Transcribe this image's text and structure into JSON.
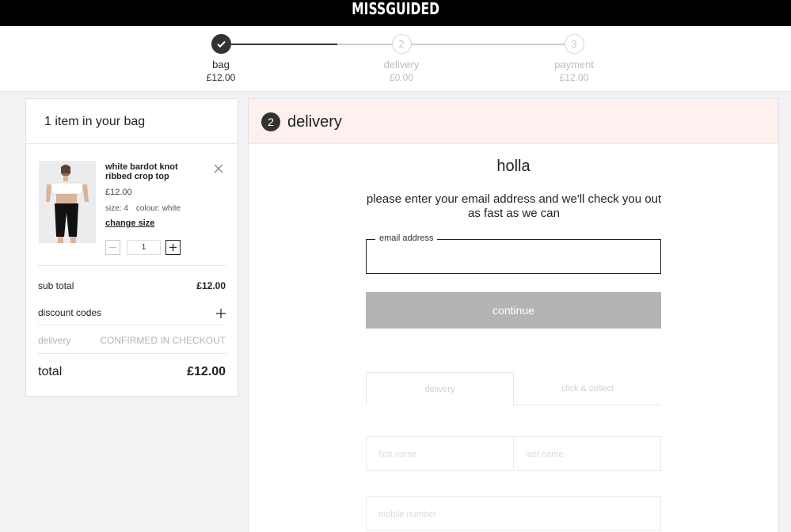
{
  "brand": {
    "logo_text": "MISSGUIDED"
  },
  "progress": {
    "steps": [
      {
        "number": "✓",
        "label": "bag",
        "amount": "£12.00",
        "state": "done"
      },
      {
        "number": "2",
        "label": "delivery",
        "amount": "£0.00",
        "state": "current"
      },
      {
        "number": "3",
        "label": "payment",
        "amount": "£12.00",
        "state": "upcoming"
      }
    ]
  },
  "bag": {
    "heading": "1 item in your bag",
    "item": {
      "name": "white bardot knot ribbed crop top",
      "price": "£12.00",
      "size": "size: 4",
      "colour": "colour: white",
      "change_size": "change size",
      "quantity": "1"
    },
    "summary": {
      "subtotal_label": "sub total",
      "subtotal_value": "£12.00",
      "discount_label": "discount codes",
      "delivery_label": "delivery",
      "delivery_value": "CONFIRMED IN CHECKOUT",
      "total_label": "total",
      "total_value": "£12.00"
    }
  },
  "delivery": {
    "step_number": "2",
    "title": "delivery",
    "greeting": "holla",
    "intro": "please enter your email address and we'll check you out as fast as we can",
    "email_label": "email address",
    "email_value": "",
    "continue_label": "continue",
    "tabs": [
      {
        "label": "delivery"
      },
      {
        "label": "click & collect"
      }
    ],
    "fields": {
      "first_name": "first name",
      "last_name": "last name",
      "mobile": "mobile number"
    }
  }
}
